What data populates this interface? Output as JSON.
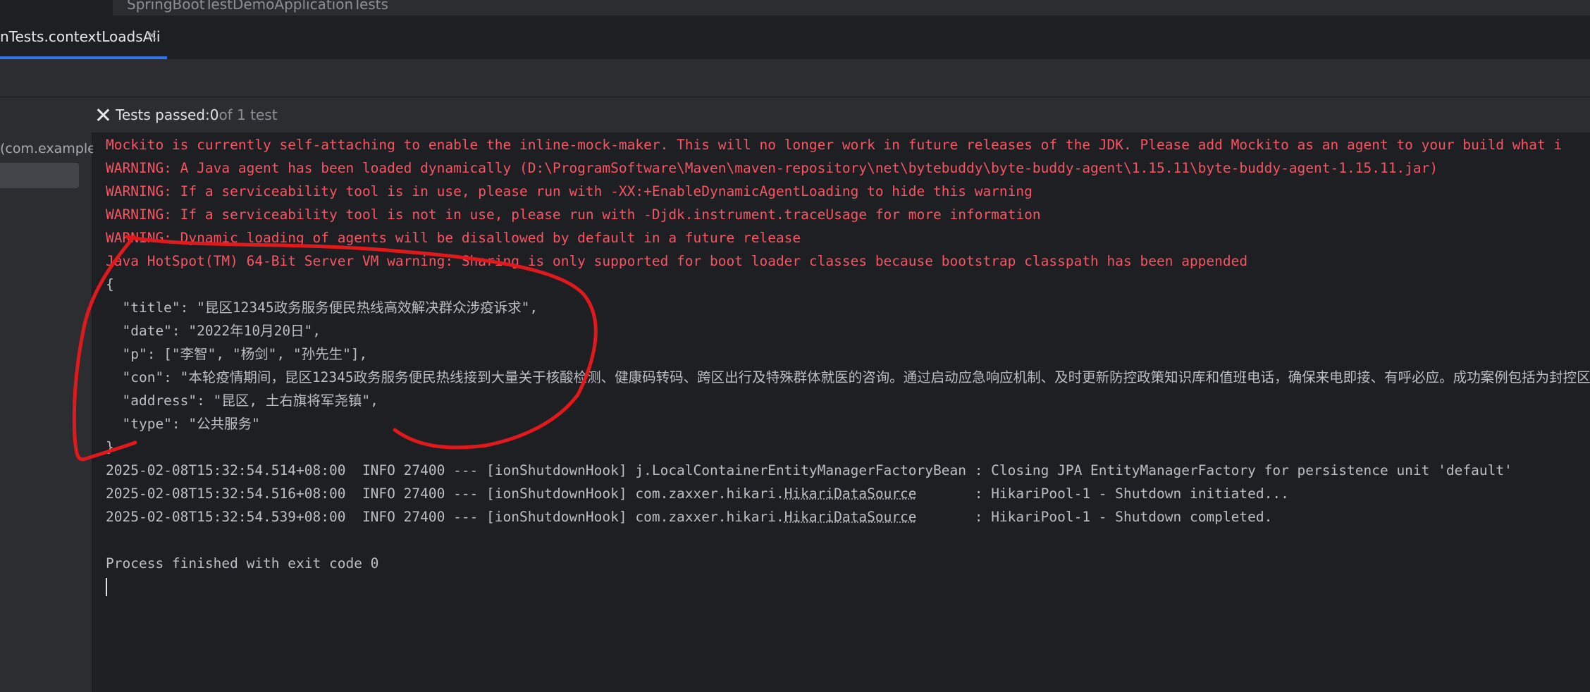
{
  "breadcrumb": {
    "file": "SpringBootTestDemoApplicationTests"
  },
  "tab": {
    "label": "nTests.contextLoadsAli",
    "close_glyph": "×"
  },
  "status": {
    "prefix": "Tests passed: ",
    "count": "0",
    "suffix": " of 1 test"
  },
  "tree": {
    "item": "(com.example."
  },
  "console": {
    "warnings": [
      "Mockito is currently self-attaching to enable the inline-mock-maker. This will no longer work in future releases of the JDK. Please add Mockito as an agent to your build what i",
      "WARNING: A Java agent has been loaded dynamically (D:\\ProgramSoftware\\Maven\\maven-repository\\net\\bytebuddy\\byte-buddy-agent\\1.15.11\\byte-buddy-agent-1.15.11.jar)",
      "WARNING: If a serviceability tool is in use, please run with -XX:+EnableDynamicAgentLoading to hide this warning",
      "WARNING: If a serviceability tool is not in use, please run with -Djdk.instrument.traceUsage for more information",
      "WARNING: Dynamic loading of agents will be disallowed by default in a future release",
      "Java HotSpot(TM) 64-Bit Server VM warning: Sharing is only supported for boot loader classes because bootstrap classpath has been appended"
    ],
    "json": [
      "{",
      "  \"title\": \"昆区12345政务服务便民热线高效解决群众涉疫诉求\",",
      "  \"date\": \"2022年10月20日\",",
      "  \"p\": [\"李智\", \"杨剑\", \"孙先生\"],",
      "  \"con\": \"本轮疫情期间，昆区12345政务服务便民热线接到大量关于核酸检测、健康码转码、跨区出行及特殊群体就医的咨询。通过启动应急响应机制、及时更新防控政策知识库和值班电话，确保来电即接、有呼必应。成功案例包括为封控区居民",
      "  \"address\": \"昆区, 土右旗将军尧镇\",",
      "  \"type\": \"公共服务\"",
      "}"
    ],
    "logs": [
      {
        "pre": "2025-02-08T15:32:54.514+08:00  INFO 27400 --- [ionShutdownHook] j.LocalContainerEntityManagerFactoryBean : Closing JPA EntityManagerFactory for persistence unit 'default'",
        "link": "",
        "post": ""
      },
      {
        "pre": "2025-02-08T15:32:54.516+08:00  INFO 27400 --- [ionShutdownHook] com.zaxxer.hikari.",
        "link": "HikariDataSource",
        "post": "       : HikariPool-1 - Shutdown initiated..."
      },
      {
        "pre": "2025-02-08T15:32:54.539+08:00  INFO 27400 --- [ionShutdownHook] com.zaxxer.hikari.",
        "link": "HikariDataSource",
        "post": "       : HikariPool-1 - Shutdown completed."
      }
    ],
    "exit": "Process finished with exit code 0"
  },
  "colors": {
    "error_red": "#f75464",
    "accent_blue": "#3574f0",
    "annotation_red": "#e0191c",
    "background": "#1e1f22"
  }
}
